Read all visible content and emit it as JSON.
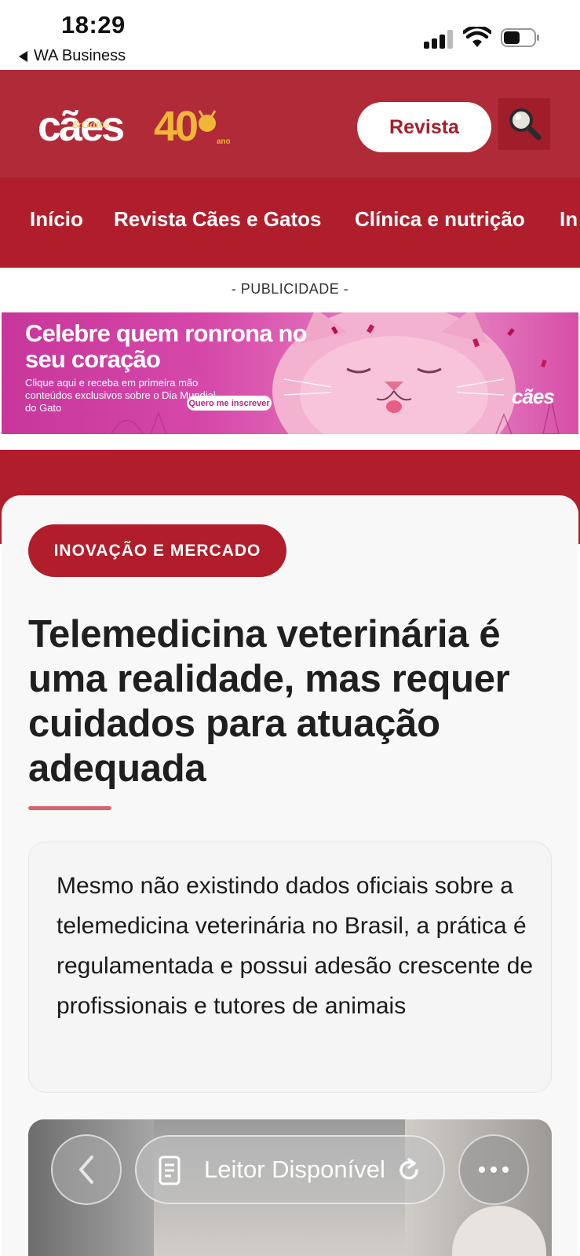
{
  "status_bar": {
    "time": "18:29",
    "back_app": "WA Business"
  },
  "header": {
    "logo_text": "cães & Gatos 40",
    "revista_label": "Revista",
    "search_icon": "magnifier-icon"
  },
  "nav": {
    "items": [
      "Início",
      "Revista Cães e Gatos",
      "Clínica e nutrição",
      "In"
    ]
  },
  "ad": {
    "label": "- PUBLICIDADE -",
    "headline": "Celebre quem ronrona no seu coração",
    "body": "Clique aqui e receba em primeira mão conteúdos exclusivos sobre o Dia Mundial do Gato",
    "cta": "Quero me inscrever",
    "brand": "cães"
  },
  "article": {
    "category": "INOVAÇÃO E MERCADO",
    "title": "Telemedicina veterinária é uma realidade, mas requer cuidados para atuação adequada",
    "summary": "Mesmo não existindo dados oficiais sobre a telemedicina veterinária no Brasil, a prática é regulamentada e possui adesão crescente de profissionais e tutores de animais"
  },
  "toolbar": {
    "reader_label": "Leitor Disponível"
  },
  "colors": {
    "header_red": "#b02a37",
    "nav_red": "#b01e2c",
    "category_red": "#b11d2b"
  }
}
